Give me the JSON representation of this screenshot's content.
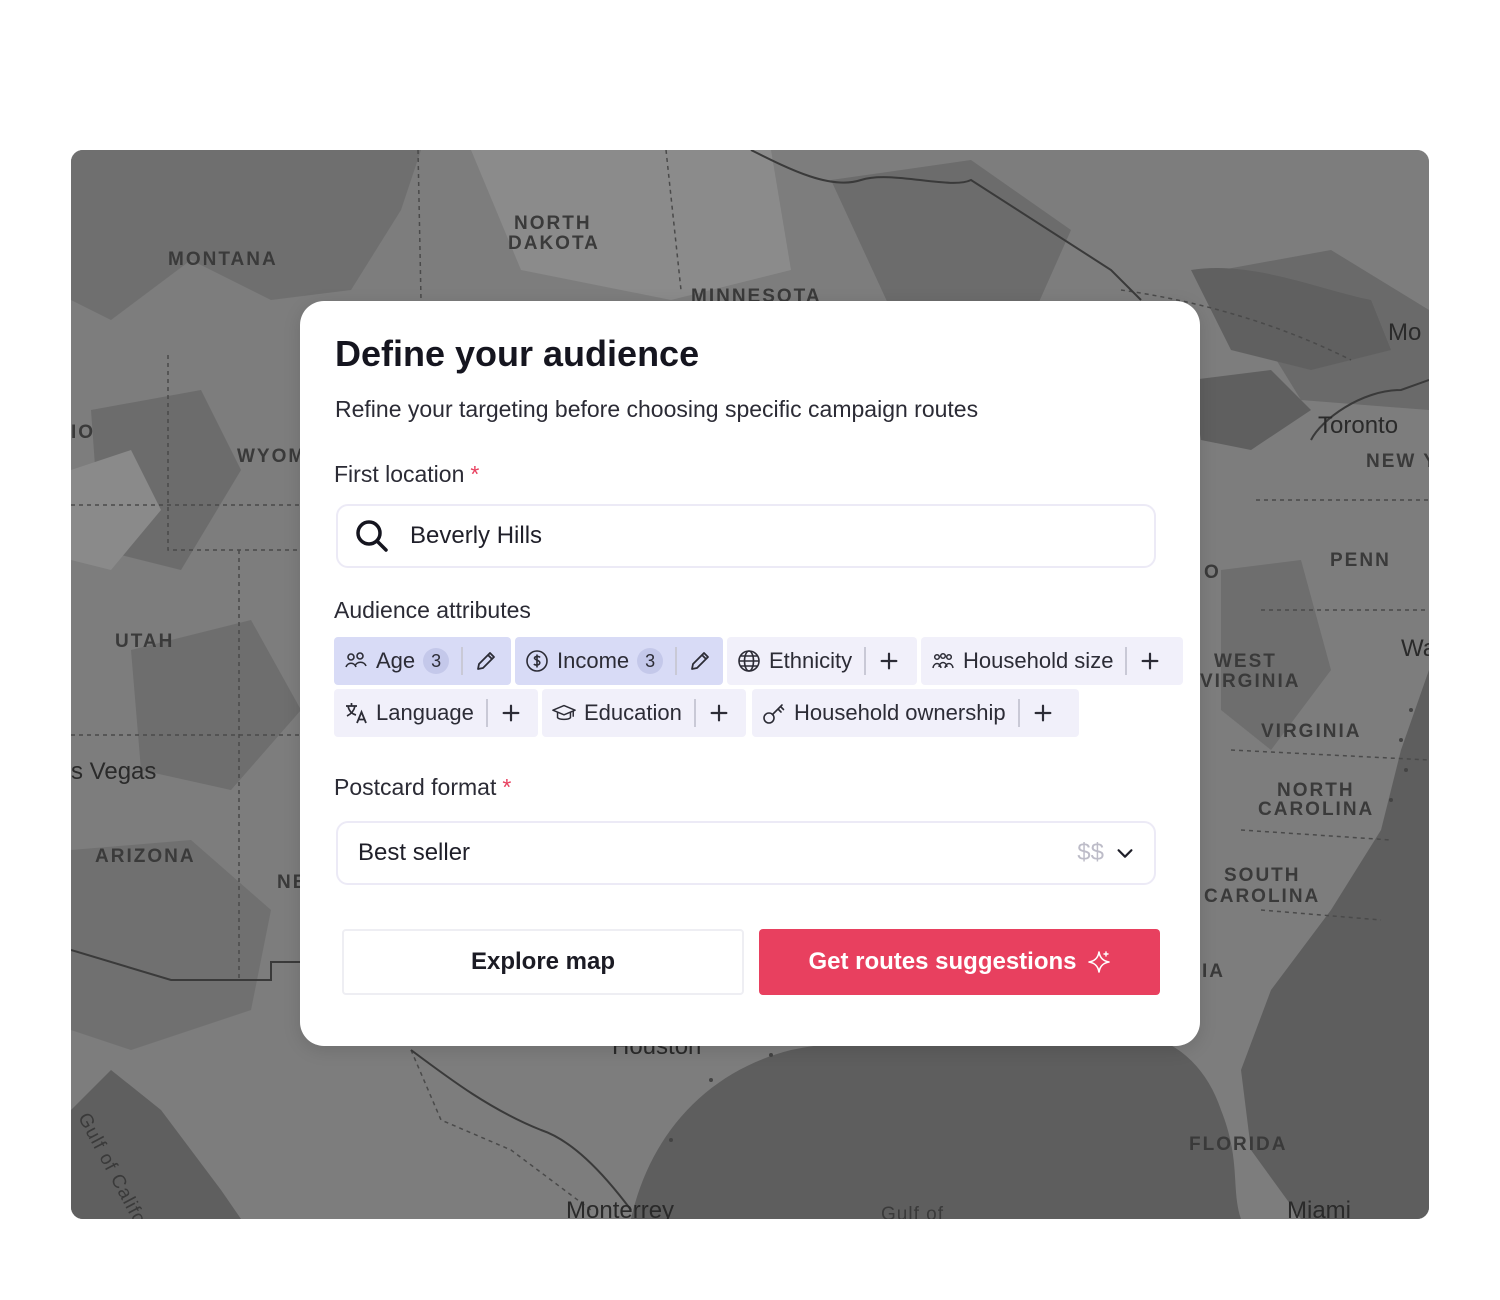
{
  "map": {
    "region_labels": [
      "MONTANA",
      "NORTH",
      "DAKOTA",
      "MINNESOTA",
      "WYOM",
      "UTAH",
      "ARIZONA",
      "NE",
      "IO",
      "NEW Y",
      "PENN",
      "O",
      "WEST",
      "VIRGINIA",
      "VIRGINIA",
      "NORTH",
      "CAROLINA",
      "SOUTH",
      "CAROLINA",
      "IA",
      "FLORIDA",
      "Gulf of",
      "Gulf of Californ"
    ],
    "city_labels": [
      "Toronto",
      "s Vegas",
      "Mo",
      "Wa",
      "Houston",
      "Monterrey",
      "Miami"
    ]
  },
  "modal": {
    "title": "Define your audience",
    "subtitle": "Refine your targeting before choosing specific campaign routes",
    "location": {
      "label": "First location",
      "required_mark": "*",
      "value": "Beverly Hills",
      "icon": "search-icon"
    },
    "attributes": {
      "label": "Audience attributes",
      "chips": [
        {
          "label": "Age",
          "count": "3",
          "active": true,
          "icon": "age-icon",
          "action": "edit-icon"
        },
        {
          "label": "Income",
          "count": "3",
          "active": true,
          "icon": "dollar-icon",
          "action": "edit-icon"
        },
        {
          "label": "Ethnicity",
          "active": false,
          "icon": "globe-icon",
          "action": "plus-icon"
        },
        {
          "label": "Household size",
          "active": false,
          "icon": "family-icon",
          "action": "plus-icon"
        },
        {
          "label": "Language",
          "active": false,
          "icon": "translate-icon",
          "action": "plus-icon"
        },
        {
          "label": "Education",
          "active": false,
          "icon": "graduation-cap-icon",
          "action": "plus-icon"
        },
        {
          "label": "Household ownership",
          "active": false,
          "icon": "key-icon",
          "action": "plus-icon"
        }
      ]
    },
    "postcard": {
      "label": "Postcard format",
      "required_mark": "*",
      "value": "Best seller",
      "price": "$$",
      "icon": "chevron-down-icon"
    },
    "buttons": {
      "secondary": "Explore map",
      "primary": "Get routes suggestions",
      "primary_icon": "sparkle-icon"
    }
  },
  "colors": {
    "accent": "#e8405f",
    "chip_active": "#d8dbf6",
    "chip_inactive": "#f1f0fa",
    "map_land": "#7e7e7e",
    "map_water": "#5f5f5f"
  }
}
